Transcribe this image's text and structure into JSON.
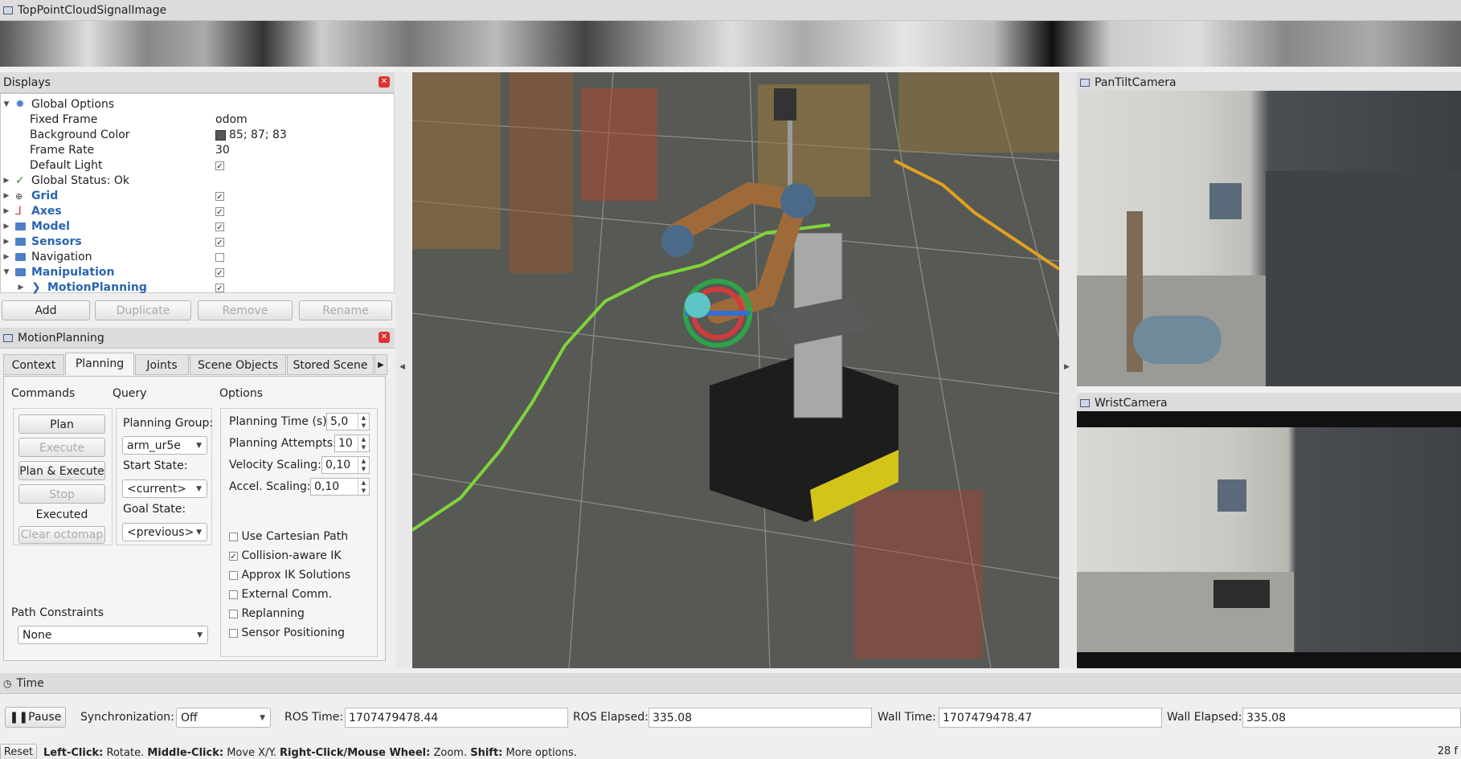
{
  "top_image": {
    "title": "TopPointCloudSignalImage"
  },
  "displays": {
    "title": "Displays",
    "rows": [
      {
        "label": "Global Options"
      },
      {
        "label": "Fixed Frame",
        "value": "odom"
      },
      {
        "label": "Background Color",
        "value": "85; 87; 83"
      },
      {
        "label": "Frame Rate",
        "value": "30"
      },
      {
        "label": "Default Light",
        "checked": true
      },
      {
        "label": "Global Status: Ok"
      },
      {
        "label": "Grid",
        "checked": true
      },
      {
        "label": "Axes",
        "checked": true
      },
      {
        "label": "Model",
        "checked": true
      },
      {
        "label": "Sensors",
        "checked": true
      },
      {
        "label": "Navigation",
        "checked": false
      },
      {
        "label": "Manipulation",
        "checked": true
      },
      {
        "label": "MotionPlanning",
        "checked": true
      }
    ],
    "buttons": {
      "add": "Add",
      "duplicate": "Duplicate",
      "remove": "Remove",
      "rename": "Rename"
    }
  },
  "motion_planning": {
    "title": "MotionPlanning",
    "tabs": [
      "Context",
      "Planning",
      "Joints",
      "Scene Objects",
      "Stored Scene"
    ],
    "active_tab": "Planning",
    "commands": {
      "header": "Commands",
      "plan": "Plan",
      "execute": "Execute",
      "plan_execute": "Plan & Execute",
      "stop": "Stop",
      "status": "Executed",
      "clear_octomap": "Clear octomap"
    },
    "query": {
      "header": "Query",
      "planning_group_label": "Planning Group:",
      "planning_group": "arm_ur5e",
      "start_state_label": "Start State:",
      "start_state": "<current>",
      "goal_state_label": "Goal State:",
      "goal_state": "<previous>"
    },
    "options": {
      "header": "Options",
      "planning_time_label": "Planning Time (s):",
      "planning_time": "5,0",
      "planning_attempts_label": "Planning Attempts:",
      "planning_attempts": "10",
      "velocity_scaling_label": "Velocity Scaling:",
      "velocity_scaling": "0,10",
      "accel_scaling_label": "Accel. Scaling:",
      "accel_scaling": "0,10",
      "checks": [
        {
          "label": "Use Cartesian Path",
          "checked": false
        },
        {
          "label": "Collision-aware IK",
          "checked": true
        },
        {
          "label": "Approx IK Solutions",
          "checked": false
        },
        {
          "label": "External Comm.",
          "checked": false
        },
        {
          "label": "Replanning",
          "checked": false
        },
        {
          "label": "Sensor Positioning",
          "checked": false
        }
      ]
    },
    "path_constraints": {
      "label": "Path Constraints",
      "value": "None"
    }
  },
  "cameras": {
    "pan_tilt": "PanTiltCamera",
    "wrist": "WristCamera"
  },
  "time": {
    "title": "Time",
    "pause": "Pause",
    "sync_label": "Synchronization:",
    "sync_value": "Off",
    "ros_time_label": "ROS Time:",
    "ros_time": "1707479478.44",
    "ros_elapsed_label": "ROS Elapsed:",
    "ros_elapsed": "335.08",
    "wall_time_label": "Wall Time:",
    "wall_time": "1707479478.47",
    "wall_elapsed_label": "Wall Elapsed:",
    "wall_elapsed": "335.08"
  },
  "status_bar": {
    "reset": "Reset",
    "hint_1_key": "Left-Click:",
    "hint_1_text": "Rotate.",
    "hint_2_key": "Middle-Click:",
    "hint_2_text": "Move X/Y.",
    "hint_3_key": "Right-Click/Mouse Wheel:",
    "hint_3_text": "Zoom.",
    "hint_4_key": "Shift:",
    "hint_4_text": "More options.",
    "fps": "28 f"
  },
  "colors": {
    "accent_blue": "#2a64b0",
    "close_red": "#dd3333",
    "viewport_bg": "#575955",
    "path_green": "#7fd53a"
  }
}
